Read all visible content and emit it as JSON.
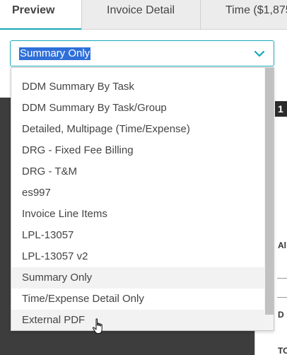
{
  "tabs": [
    {
      "label": "Preview"
    },
    {
      "label": "Invoice Detail"
    },
    {
      "label": "Time ($1,875"
    }
  ],
  "select": {
    "value": "Summary Only"
  },
  "options": [
    {
      "label": "DDM Summary By Task"
    },
    {
      "label": "DDM Summary By Task/Group"
    },
    {
      "label": "Detailed, Multipage (Time/Expense)"
    },
    {
      "label": "DRG - Fixed Fee Billing"
    },
    {
      "label": "DRG - T&M"
    },
    {
      "label": "es997"
    },
    {
      "label": "Invoice Line Items"
    },
    {
      "label": "LPL-13057"
    },
    {
      "label": "LPL-13057 v2"
    },
    {
      "label": "Summary Only"
    },
    {
      "label": "Time/Expense Detail Only"
    },
    {
      "label": "External PDF"
    }
  ],
  "background": {
    "right_bar_text": "1",
    "right_labels": [
      "Al",
      "D",
      "TO"
    ]
  },
  "colors": {
    "accent": "#18a8b8",
    "selection": "#2f6fd8",
    "dark_panel": "#3d3d3d"
  }
}
